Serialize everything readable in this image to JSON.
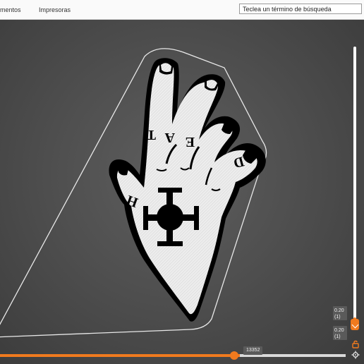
{
  "menu": {
    "items": [
      "mentos",
      "Impresoras"
    ]
  },
  "search": {
    "value": "Teclea un término de búsqueda"
  },
  "model": {
    "tattoo_letters": [
      "T",
      "A",
      "E",
      "D",
      "H"
    ]
  },
  "layer_slider": {
    "top_label": "0.20\n(1)",
    "bottom_label": "0.20\n(1)"
  },
  "layer_labels": {
    "top_value": "0.20",
    "top_count": "(1)",
    "bottom_value": "0.20",
    "bottom_count": "(1)"
  },
  "progress": {
    "value": 13352,
    "label": "13352"
  },
  "icons": {
    "lock": "lock-icon",
    "gear": "gear-icon"
  },
  "colors": {
    "accent": "#f07a1e",
    "viewport": "#4a4a4a",
    "model_fill": "#e9e9e9",
    "model_border": "#000000"
  }
}
